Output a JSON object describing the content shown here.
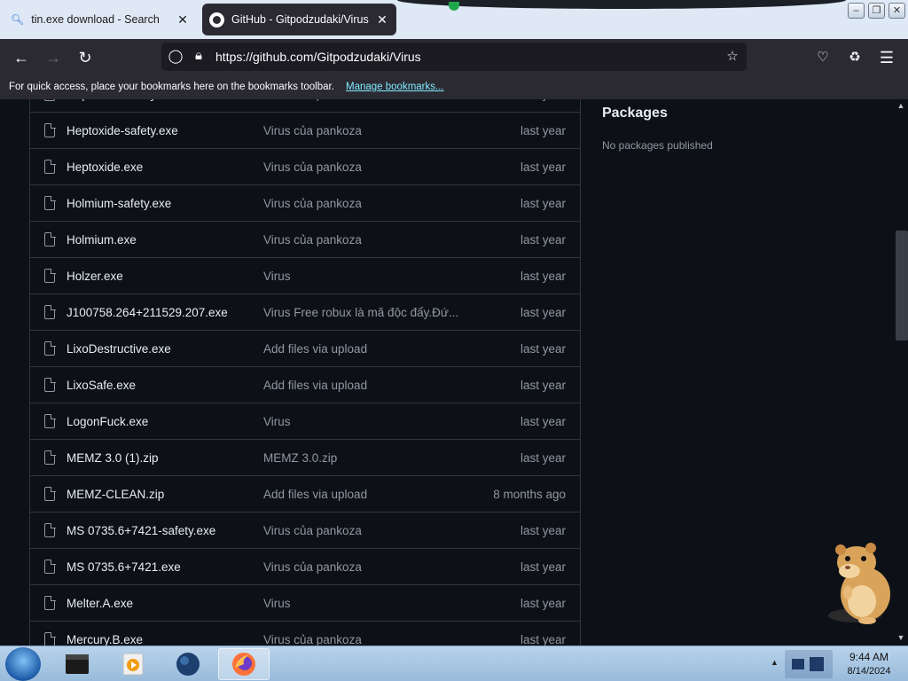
{
  "browser": {
    "tabs": [
      {
        "label": "tin.exe download - Search",
        "icon": "search-icon",
        "active": false
      },
      {
        "label": "GitHub - Gitpodzudaki/Virus",
        "icon": "github-icon",
        "active": true
      }
    ],
    "url": "https://github.com/Gitpodzudaki/Virus",
    "bookmarks_text": "For quick access, place your bookmarks here on the bookmarks toolbar.",
    "bookmarks_link": "Manage bookmarks..."
  },
  "files": [
    {
      "name": "Heptoxide-safety.exe",
      "message": "Virus của pankoza",
      "date": "last year"
    },
    {
      "name": "Heptoxide-safety.exe",
      "message": "Virus của pankoza",
      "date": "last year"
    },
    {
      "name": "Heptoxide.exe",
      "message": "Virus của pankoza",
      "date": "last year"
    },
    {
      "name": "Holmium-safety.exe",
      "message": "Virus của pankoza",
      "date": "last year"
    },
    {
      "name": "Holmium.exe",
      "message": "Virus của pankoza",
      "date": "last year"
    },
    {
      "name": "Holzer.exe",
      "message": "Virus",
      "date": "last year"
    },
    {
      "name": "J100758.264+211529.207.exe",
      "message": "Virus Free robux là mã độc đấy.Đứ...",
      "date": "last year"
    },
    {
      "name": "LixoDestructive.exe",
      "message": "Add files via upload",
      "date": "last year"
    },
    {
      "name": "LixoSafe.exe",
      "message": "Add files via upload",
      "date": "last year"
    },
    {
      "name": "LogonFuck.exe",
      "message": "Virus",
      "date": "last year"
    },
    {
      "name": "MEMZ 3.0 (1).zip",
      "message": "MEMZ 3.0.zip",
      "date": "last year"
    },
    {
      "name": "MEMZ-CLEAN.zip",
      "message": "Add files via upload",
      "date": "8 months ago"
    },
    {
      "name": "MS 0735.6+7421-safety.exe",
      "message": "Virus của pankoza",
      "date": "last year"
    },
    {
      "name": "MS 0735.6+7421.exe",
      "message": "Virus của pankoza",
      "date": "last year"
    },
    {
      "name": "Melter.A.exe",
      "message": "Virus",
      "date": "last year"
    },
    {
      "name": "Mercury.B.exe",
      "message": "Virus của pankoza",
      "date": "last year"
    }
  ],
  "sidebar": {
    "packages_title": "Packages",
    "packages_empty": "No packages published"
  },
  "taskbar": {
    "time": "9:44 AM",
    "date": "8/14/2024"
  }
}
